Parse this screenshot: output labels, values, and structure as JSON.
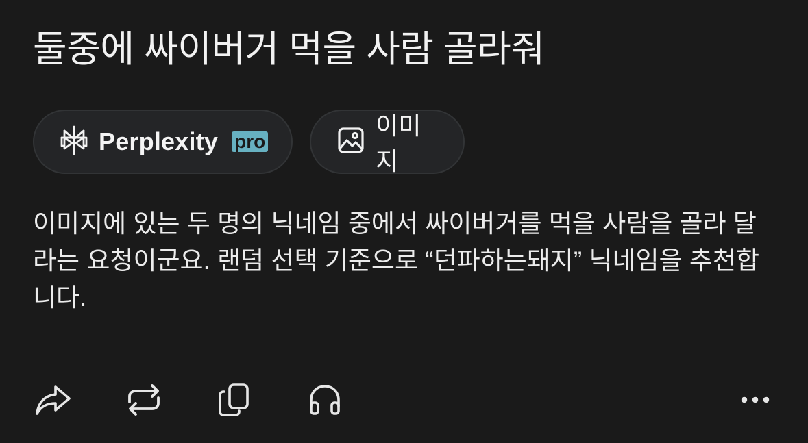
{
  "question": "둘중에 싸이버거 먹을 사람 골라줘",
  "chips": {
    "source_label": "Perplexity",
    "source_badge": "pro",
    "image_label": "이미지"
  },
  "answer": {
    "text": "이미지에 있는 두 명의 닉네임 중에서 싸이버거를 먹을 사람을 골라 달라는 요청이군요. 랜덤 선택 기준으로 “던파하는돼지” 닉네임을 추천합니다."
  },
  "actions": {
    "icons": [
      "share-icon",
      "repeat-icon",
      "copy-icon",
      "headphones-icon",
      "more-icon"
    ]
  },
  "colors": {
    "background": "#1a1a1a",
    "chip_bg": "#242527",
    "pro_badge": "#67b1c1",
    "text": "#f0f0f0"
  }
}
